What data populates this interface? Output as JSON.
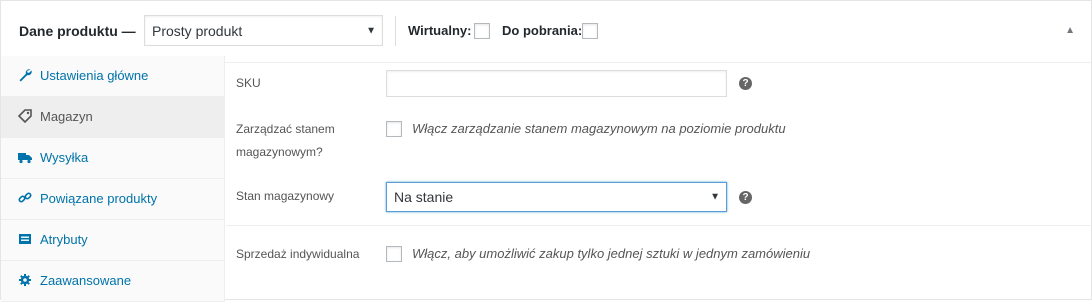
{
  "header": {
    "title": "Dane produktu —",
    "product_type": "Prosty produkt",
    "virtual_label": "Wirtualny:",
    "downloadable_label": "Do pobrania:"
  },
  "tabs": [
    {
      "label": "Ustawienia główne",
      "icon": "wrench-icon"
    },
    {
      "label": "Magazyn",
      "icon": "tag-icon"
    },
    {
      "label": "Wysyłka",
      "icon": "truck-icon"
    },
    {
      "label": "Powiązane produkty",
      "icon": "link-icon"
    },
    {
      "label": "Atrybuty",
      "icon": "list-icon"
    },
    {
      "label": "Zaawansowane",
      "icon": "gear-icon"
    }
  ],
  "active_tab": "Magazyn",
  "fields": {
    "sku_label": "SKU",
    "sku_value": "",
    "manage_stock_label_1": "Zarządzać stanem",
    "manage_stock_label_2": "magazynowym?",
    "manage_stock_desc": "Włącz zarządzanie stanem magazynowym na poziomie produktu",
    "stock_status_label": "Stan magazynowy",
    "stock_status_value": "Na stanie",
    "sold_individually_label": "Sprzedaż indywidualna",
    "sold_individually_desc": "Włącz, aby umożliwić zakup tylko jednej sztuki w jednym zamówieniu"
  },
  "icons": {
    "help": "?",
    "dropdown": "▼",
    "collapse": "▲"
  },
  "colors": {
    "link": "#0073aa",
    "focus_border": "#5b9dd9"
  }
}
